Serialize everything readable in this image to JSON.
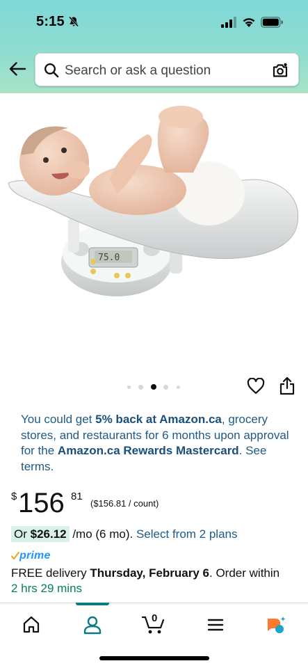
{
  "status_bar": {
    "time": "5:15"
  },
  "header": {
    "search_placeholder": "Search or ask a question"
  },
  "carousel": {
    "image_count": 5,
    "active_index": 2
  },
  "promo": {
    "part1": "You could get ",
    "bold1": "5% back at Amazon.ca",
    "part2": ", grocery stores, and restaurants for 6 months upon approval for the ",
    "bold2": "Amazon.ca Rewards Mastercard",
    "part3": ". See terms."
  },
  "price": {
    "currency": "$",
    "whole": "156",
    "fraction": "81",
    "unit_price": "($156.81 / count)"
  },
  "monthly": {
    "prefix": "Or ",
    "amount": "$26.12",
    "term": " /mo (6 mo). ",
    "link": "Select from 2 plans"
  },
  "prime": {
    "label": "prime"
  },
  "delivery": {
    "prefix": "FREE delivery ",
    "date": "Thursday, February 6",
    "middle": ". Order within ",
    "countdown": "2 hrs 29 mins"
  },
  "bottom_nav": {
    "items": [
      "home-icon",
      "account-icon",
      "cart-icon",
      "menu-icon",
      "rufus-icon"
    ],
    "cart_count": "0",
    "active": "account-icon"
  },
  "colors": {
    "header_gradient_top": "#7fd8d8",
    "header_gradient_bottom": "#a9e4c9",
    "link": "#1f5a87",
    "prime_blue": "#1a98ff",
    "green": "#067d62",
    "active_tab": "#0a7b83"
  }
}
